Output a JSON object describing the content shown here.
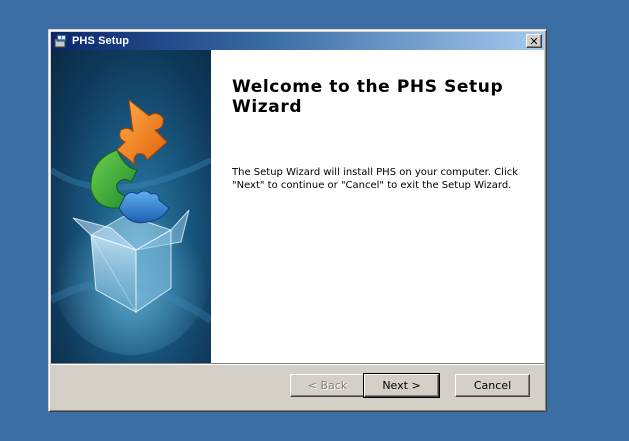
{
  "window": {
    "title": "PHS Setup",
    "close_glyph": "✕"
  },
  "content": {
    "heading": "Welcome to the PHS Setup Wizard",
    "body": "The Setup Wizard will install PHS on your computer.  Click \"Next\" to continue or \"Cancel\" to exit the Setup Wizard."
  },
  "buttons": {
    "back": "< Back",
    "next": "Next >",
    "cancel": "Cancel"
  },
  "icons": {
    "app": "installer-icon",
    "banner": "puzzle-box-illustration"
  },
  "colors": {
    "desktop": "#3a6ea5",
    "titlebar_start": "#0a246a",
    "titlebar_end": "#a6caf0",
    "face": "#d4d0c8"
  }
}
